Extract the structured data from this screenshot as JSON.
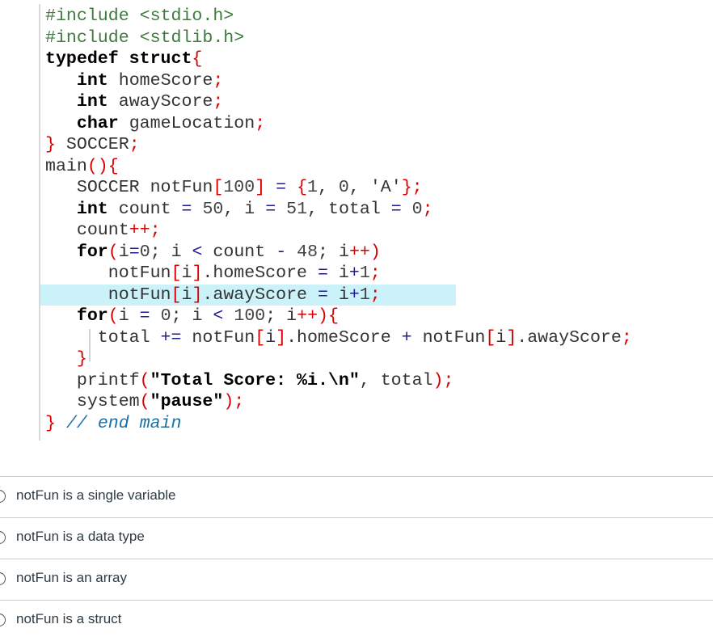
{
  "code_snippet": {
    "lines": [
      [
        {
          "t": "#include <stdio.h>",
          "c": "pp"
        }
      ],
      [
        {
          "t": "#include <stdlib.h>",
          "c": "pp"
        }
      ],
      [
        {
          "t": "typedef struct",
          "c": "kw"
        },
        {
          "t": "{",
          "c": "pn"
        }
      ],
      [
        {
          "t": "   "
        },
        {
          "t": "int",
          "c": "kw"
        },
        {
          "t": " homeScore",
          "c": "id"
        },
        {
          "t": ";",
          "c": "pn"
        }
      ],
      [
        {
          "t": "   "
        },
        {
          "t": "int",
          "c": "kw"
        },
        {
          "t": " awayScore",
          "c": "id"
        },
        {
          "t": ";",
          "c": "pn"
        }
      ],
      [
        {
          "t": "   "
        },
        {
          "t": "char",
          "c": "kw"
        },
        {
          "t": " gameLocation",
          "c": "id"
        },
        {
          "t": ";",
          "c": "pn"
        }
      ],
      [
        {
          "t": "}",
          "c": "pn"
        },
        {
          "t": " SOCCER",
          "c": "id"
        },
        {
          "t": ";",
          "c": "pn"
        }
      ],
      [
        {
          "t": "main",
          "c": "id"
        },
        {
          "t": "(){",
          "c": "pn"
        }
      ],
      [
        {
          "t": "   SOCCER notFun",
          "c": "id"
        },
        {
          "t": "[",
          "c": "pn"
        },
        {
          "t": "100",
          "c": "num"
        },
        {
          "t": "]",
          "c": "pn"
        },
        {
          "t": " = ",
          "c": "op"
        },
        {
          "t": "{",
          "c": "pn"
        },
        {
          "t": "1",
          "c": "num"
        },
        {
          "t": ", ",
          "c": "id"
        },
        {
          "t": "0",
          "c": "num"
        },
        {
          "t": ", ",
          "c": "id"
        },
        {
          "t": "'A'",
          "c": "id"
        },
        {
          "t": "};",
          "c": "pn"
        }
      ],
      [
        {
          "t": "   "
        },
        {
          "t": "int",
          "c": "kw"
        },
        {
          "t": " count ",
          "c": "id"
        },
        {
          "t": "=",
          "c": "op"
        },
        {
          "t": " ",
          "c": "id"
        },
        {
          "t": "50",
          "c": "num"
        },
        {
          "t": ", i ",
          "c": "id"
        },
        {
          "t": "=",
          "c": "op"
        },
        {
          "t": " ",
          "c": "id"
        },
        {
          "t": "51",
          "c": "num"
        },
        {
          "t": ", total ",
          "c": "id"
        },
        {
          "t": "=",
          "c": "op"
        },
        {
          "t": " ",
          "c": "id"
        },
        {
          "t": "0",
          "c": "num"
        },
        {
          "t": ";",
          "c": "pn"
        }
      ],
      [
        {
          "t": "   count",
          "c": "id"
        },
        {
          "t": "++;",
          "c": "pn"
        }
      ],
      [
        {
          "t": "   "
        },
        {
          "t": "for",
          "c": "kw"
        },
        {
          "t": "(",
          "c": "pn"
        },
        {
          "t": "i",
          "c": "id"
        },
        {
          "t": "=",
          "c": "op"
        },
        {
          "t": "0",
          "c": "num"
        },
        {
          "t": "; i ",
          "c": "id"
        },
        {
          "t": "<",
          "c": "op"
        },
        {
          "t": " count ",
          "c": "id"
        },
        {
          "t": "-",
          "c": "op"
        },
        {
          "t": " ",
          "c": "id"
        },
        {
          "t": "48",
          "c": "num"
        },
        {
          "t": "; i",
          "c": "id"
        },
        {
          "t": "++)",
          "c": "pn"
        }
      ],
      [
        {
          "t": "      notFun",
          "c": "id"
        },
        {
          "t": "[",
          "c": "pn"
        },
        {
          "t": "i",
          "c": "id"
        },
        {
          "t": "]",
          "c": "pn"
        },
        {
          "t": ".homeScore ",
          "c": "id"
        },
        {
          "t": "=",
          "c": "op"
        },
        {
          "t": " i",
          "c": "id"
        },
        {
          "t": "+",
          "c": "op"
        },
        {
          "t": "1",
          "c": "num"
        },
        {
          "t": ";",
          "c": "pn"
        }
      ],
      [
        {
          "t": "      notFun",
          "c": "id"
        },
        {
          "t": "[",
          "c": "pn"
        },
        {
          "t": "i",
          "c": "id"
        },
        {
          "t": "]",
          "c": "pn"
        },
        {
          "t": ".awayScore ",
          "c": "id"
        },
        {
          "t": "=",
          "c": "op"
        },
        {
          "t": " i",
          "c": "id"
        },
        {
          "t": "+",
          "c": "op"
        },
        {
          "t": "1",
          "c": "num"
        },
        {
          "t": ";",
          "c": "pn"
        }
      ],
      [
        {
          "t": "   "
        },
        {
          "t": "for",
          "c": "kw"
        },
        {
          "t": "(",
          "c": "pn"
        },
        {
          "t": "i ",
          "c": "id"
        },
        {
          "t": "=",
          "c": "op"
        },
        {
          "t": " ",
          "c": "id"
        },
        {
          "t": "0",
          "c": "num"
        },
        {
          "t": "; i ",
          "c": "id"
        },
        {
          "t": "<",
          "c": "op"
        },
        {
          "t": " ",
          "c": "id"
        },
        {
          "t": "100",
          "c": "num"
        },
        {
          "t": "; i",
          "c": "id"
        },
        {
          "t": "++){",
          "c": "pn"
        }
      ],
      [
        {
          "t": "     total ",
          "c": "id"
        },
        {
          "t": "+=",
          "c": "op"
        },
        {
          "t": " notFun",
          "c": "id"
        },
        {
          "t": "[",
          "c": "pn"
        },
        {
          "t": "i",
          "c": "id"
        },
        {
          "t": "]",
          "c": "pn"
        },
        {
          "t": ".homeScore ",
          "c": "id"
        },
        {
          "t": "+",
          "c": "op"
        },
        {
          "t": " notFun",
          "c": "id"
        },
        {
          "t": "[",
          "c": "pn"
        },
        {
          "t": "i",
          "c": "id"
        },
        {
          "t": "]",
          "c": "pn"
        },
        {
          "t": ".awayScore",
          "c": "id"
        },
        {
          "t": ";",
          "c": "pn"
        }
      ],
      [
        {
          "t": "   "
        },
        {
          "t": "}",
          "c": "pn"
        }
      ],
      [
        {
          "t": "   printf",
          "c": "id"
        },
        {
          "t": "(",
          "c": "pn"
        },
        {
          "t": "\"Total Score: %i.\\n\"",
          "c": "str"
        },
        {
          "t": ", total",
          "c": "id"
        },
        {
          "t": ");",
          "c": "pn"
        }
      ],
      [
        {
          "t": "   system",
          "c": "id"
        },
        {
          "t": "(",
          "c": "pn"
        },
        {
          "t": "\"pause\"",
          "c": "str"
        },
        {
          "t": ");",
          "c": "pn"
        }
      ],
      [
        {
          "t": "}",
          "c": "pn"
        },
        {
          "t": " "
        },
        {
          "t": "// end main",
          "c": "cm"
        }
      ]
    ],
    "highlighted_line": 13
  },
  "answer_options": [
    {
      "label": "notFun is a single variable",
      "selected": false
    },
    {
      "label": "notFun is a data type",
      "selected": false
    },
    {
      "label": "notFun is an array",
      "selected": false
    },
    {
      "label": "notFun is a struct",
      "selected": false
    }
  ]
}
